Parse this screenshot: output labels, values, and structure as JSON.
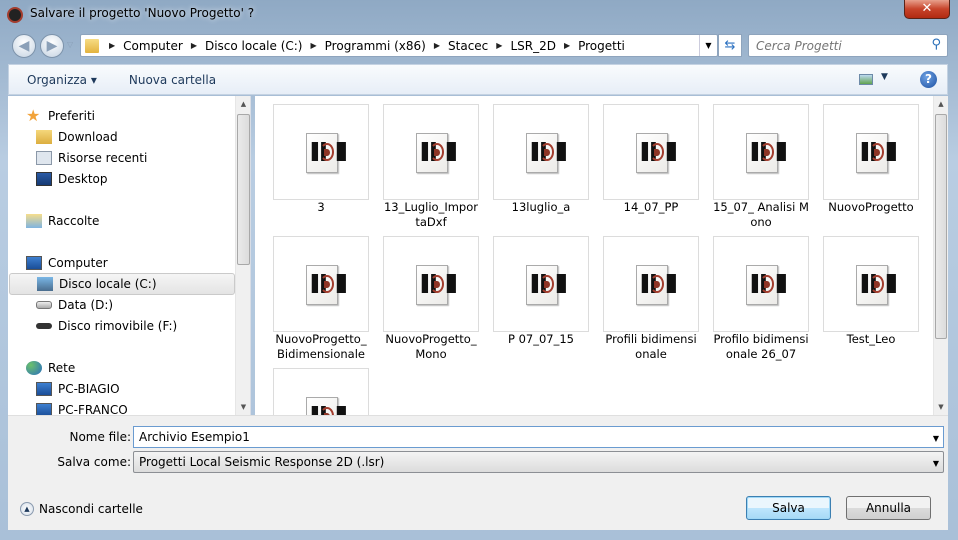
{
  "window": {
    "title": "Salvare il progetto 'Nuovo Progetto' ?",
    "close": "✕"
  },
  "address": {
    "crumbs": [
      "Computer",
      "Disco locale (C:)",
      "Programmi (x86)",
      "Stacec",
      "LSR_2D",
      "Progetti"
    ]
  },
  "search": {
    "placeholder": "Cerca Progetti"
  },
  "toolbar": {
    "organize": "Organizza ▾",
    "new_folder": "Nuova cartella",
    "help": "?"
  },
  "nav": {
    "favorites": "Preferiti",
    "download": "Download",
    "recent": "Risorse recenti",
    "desktop": "Desktop",
    "libraries": "Raccolte",
    "computer": "Computer",
    "disk_c": "Disco locale (C:)",
    "disk_d": "Data (D:)",
    "disk_f": "Disco rimovibile (F:)",
    "network": "Rete",
    "pc1": "PC-BIAGIO",
    "pc2": "PC-FRANCO"
  },
  "files": [
    "3",
    "13_Luglio_ImportaDxf",
    "13luglio_a",
    "14_07_PP",
    "15_07_ Analisi Mono",
    "NuovoProgetto",
    "NuovoProgetto_ Bidimensionale",
    "NuovoProgetto_ Mono",
    "P 07_07_15",
    "Profili bidimensionale",
    "Profilo bidimensionale 26_07",
    "Test_Leo",
    ""
  ],
  "form": {
    "filename_label": "Nome file:",
    "filename_value": "Archivio Esempio1",
    "type_label": "Salva come:",
    "type_value": "Progetti Local Seismic Response 2D (.lsr)"
  },
  "buttons": {
    "save": "Salva",
    "cancel": "Annulla",
    "hide_folders": "Nascondi cartelle"
  }
}
